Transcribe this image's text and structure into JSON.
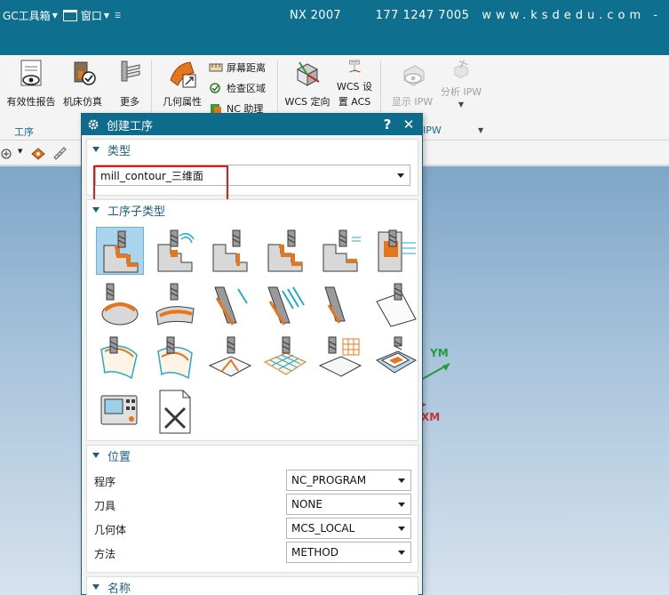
{
  "titlebar": {
    "menu_toolbox": "GC工具箱",
    "menu_window": "窗口",
    "app_title": "NX 2007",
    "contact": "177 1247 7005",
    "website": "www.ksdedu.com -"
  },
  "ribbon": {
    "validity_report": "有效性报告",
    "machine_sim": "机床仿真",
    "more": "更多",
    "geometry_props": "几何属性",
    "screen_distance": "屏幕距离",
    "check_area": "检查区域",
    "nc_assist": "NC 助理",
    "wcs_orient": "WCS 定向",
    "wcs_set": "WCS 设",
    "wcs_set_line2": "置 ACS",
    "show_ipw": "显示 IPW",
    "analyze_ipw": "分析 IPW",
    "group_operation": "工序",
    "group_ipw": "IPW"
  },
  "viewport": {
    "axis_y": "YM",
    "axis_x": "XM"
  },
  "dialog": {
    "title": "创建工序",
    "help": "?",
    "close": "✕",
    "type_section": "类型",
    "type_value": "mill_contour_三维面",
    "subtype_section": "工序子类型",
    "location_section": "位置",
    "name_section": "名称",
    "location": [
      {
        "label": "程序",
        "value": "NC_PROGRAM"
      },
      {
        "label": "刀具",
        "value": "NONE"
      },
      {
        "label": "几何体",
        "value": "MCS_LOCAL"
      },
      {
        "label": "方法",
        "value": "METHOD"
      }
    ]
  },
  "colors": {
    "titlebar": "#0e6f8f",
    "accent": "#1c5f82",
    "highlight": "#e31a1a",
    "orange": "#e8751a"
  }
}
